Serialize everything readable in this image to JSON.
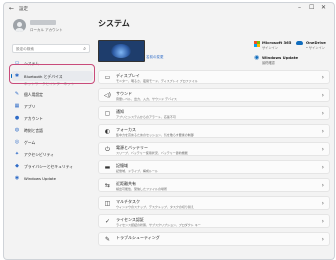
{
  "window": {
    "title": "設定",
    "back_icon": "back-arrow-icon",
    "minimize": "–",
    "maximize": "☐",
    "close": "✕"
  },
  "user": {
    "account": "ローカル アカウント"
  },
  "search": {
    "placeholder": "設定の検索",
    "icon": "search-icon"
  },
  "nav": {
    "items": [
      {
        "label": "システム",
        "icon": "system-icon",
        "glyph": "▭"
      },
      {
        "label": "Bluetooth とデバイス",
        "icon": "bluetooth-icon",
        "glyph": "✱",
        "selected": true
      },
      {
        "label": "ネットワークとインターネット",
        "icon": "network-icon",
        "glyph": "◈"
      },
      {
        "label": "個人用設定",
        "icon": "brush-icon",
        "glyph": "✎"
      },
      {
        "label": "アプリ",
        "icon": "apps-icon",
        "glyph": "▦"
      },
      {
        "label": "アカウント",
        "icon": "account-icon",
        "glyph": "●"
      },
      {
        "label": "時刻と言語",
        "icon": "globe-icon",
        "glyph": "◍"
      },
      {
        "label": "ゲーム",
        "icon": "game-icon",
        "glyph": "◎"
      },
      {
        "label": "アクセシビリティ",
        "icon": "accessibility-icon",
        "glyph": "✦"
      },
      {
        "label": "プライバシーとセキュリティ",
        "icon": "shield-icon",
        "glyph": "◆"
      },
      {
        "label": "Windows Update",
        "icon": "update-icon",
        "glyph": "◉"
      }
    ]
  },
  "main": {
    "title": "システム",
    "device_rename": "名前の変更",
    "tiles": {
      "ms365": {
        "title": "Microsoft 365",
        "sub": "サインイン"
      },
      "onedrive": {
        "title": "OneDrive",
        "sub": "• サインイン"
      },
      "update": {
        "title": "Windows Update",
        "sub": "最終確認"
      }
    },
    "settings": [
      {
        "icon": "display-icon",
        "glyph": "▭",
        "title": "ディスプレイ",
        "sub": "モニター、明るさ、夜間モード、ディスプレイ プロファイル"
      },
      {
        "icon": "sound-icon",
        "glyph": "◁)",
        "title": "サウンド",
        "sub": "音量レベル、出力、入力、サウンド デバイス"
      },
      {
        "icon": "notification-icon",
        "glyph": "▢",
        "title": "通知",
        "sub": "アプリとシステムからのアラート、応答不可"
      },
      {
        "icon": "focus-icon",
        "glyph": "◐",
        "title": "フォーカス",
        "sub": "集中力を高めるためのセッション、気を散らす要素の制御"
      },
      {
        "icon": "power-icon",
        "glyph": "⏻",
        "title": "電源とバッテリー",
        "sub": "スリープ、バッテリー使用状況、バッテリー節約機能"
      },
      {
        "icon": "storage-icon",
        "glyph": "▬",
        "title": "記憶域",
        "sub": "記憶域、ドライブ、構成ルール"
      },
      {
        "icon": "nearby-sharing-icon",
        "glyph": "⇆",
        "title": "近距離共有",
        "sub": "検出可能性、受信したファイルの場所"
      },
      {
        "icon": "multitasking-icon",
        "glyph": "◫",
        "title": "マルチタスク",
        "sub": "ウィンドウのスナップ、デスクトップ、タスクの切り替え"
      },
      {
        "icon": "activation-icon",
        "glyph": "✓",
        "title": "ライセンス認証",
        "sub": "ライセンス認証の状態、サブスクリプション、プロダクト キー"
      },
      {
        "icon": "troubleshoot-icon",
        "glyph": "✎",
        "title": "トラブルシューティング",
        "sub": ""
      }
    ],
    "chevron": "›"
  },
  "colors": {
    "accent": "#0067c0",
    "highlight": "#c94b7a"
  }
}
